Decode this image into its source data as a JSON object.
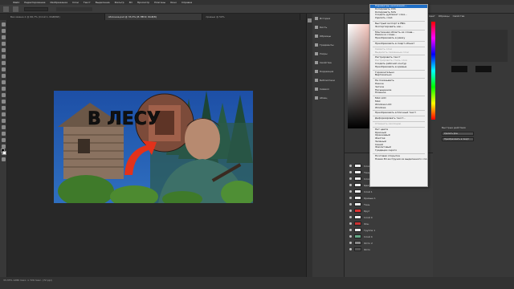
{
  "menubar": {
    "items": [
      "Файл",
      "Редактирование",
      "Изображение",
      "Слои",
      "Текст",
      "Выделение",
      "Фильтр",
      "3D",
      "Просмотр",
      "Плагины",
      "Окно",
      "Справка"
    ]
  },
  "tabs": [
    {
      "label": "Без имени-1 @ 66,7% (Слой 1, RGB/8#)"
    },
    {
      "label": "обложка.psd @ 33,3% (В ЛЕСУ, RGB/8)"
    },
    {
      "label": "превью @ 50%"
    }
  ],
  "artwork": {
    "title": "В ЛЕСУ"
  },
  "status": {
    "text": "33,33%   1280 пикс. x 720 пикс. (72 ppi)"
  },
  "history": {
    "items": [
      "История",
      "Кисть",
      "Образцы",
      "Градиенты",
      "Узоры",
      "Свойства",
      "Коррекция",
      "Библиотеки",
      "Символ",
      "Абзац"
    ]
  },
  "contextmenu": {
    "items": [
      {
        "label": "Параметры наложения...",
        "state": "hl"
      },
      {
        "label": "Копировать CSS",
        "state": ""
      },
      {
        "label": "Копировать SVG",
        "state": ""
      },
      {
        "label": "Создать дубликат слоя...",
        "state": ""
      },
      {
        "label": "Удалить слой",
        "state": ""
      },
      {
        "sep": true
      },
      {
        "label": "Быстрый экспорт в PNG",
        "state": ""
      },
      {
        "label": "Экспортировать как...",
        "state": ""
      },
      {
        "sep": true
      },
      {
        "label": "Монтажная область из слоев...",
        "state": ""
      },
      {
        "label": "Рамка из слоев...",
        "state": ""
      },
      {
        "label": "Преобразовать в рамку",
        "state": ""
      },
      {
        "sep": true
      },
      {
        "label": "Преобразовать в смарт-объект",
        "state": ""
      },
      {
        "sep": true
      },
      {
        "label": "Связать слои",
        "state": "dis"
      },
      {
        "label": "Выделить связанные слои",
        "state": "dis"
      },
      {
        "sep": true
      },
      {
        "label": "Растрировать текст",
        "state": ""
      },
      {
        "label": "Растрировать стиль слоя",
        "state": "dis"
      },
      {
        "label": "Создать рабочий контур",
        "state": ""
      },
      {
        "label": "Преобразовать в кривые",
        "state": ""
      },
      {
        "sep": true
      },
      {
        "label": "Горизонтально",
        "state": ""
      },
      {
        "label": "Вертикально",
        "state": ""
      },
      {
        "sep": true
      },
      {
        "label": "Не показывать",
        "state": ""
      },
      {
        "label": "Резкое",
        "state": ""
      },
      {
        "label": "Четкое",
        "state": ""
      },
      {
        "label": "Насыщенное",
        "state": ""
      },
      {
        "label": "Плавное",
        "state": ""
      },
      {
        "sep": true
      },
      {
        "label": "MAC LCD",
        "state": ""
      },
      {
        "label": "MAC",
        "state": ""
      },
      {
        "label": "Windows LCD",
        "state": ""
      },
      {
        "label": "Windows",
        "state": ""
      },
      {
        "sep": true
      },
      {
        "label": "Преобразовать в блочный текст",
        "state": ""
      },
      {
        "sep": true
      },
      {
        "label": "Деформировать текст...",
        "state": ""
      },
      {
        "sep": true
      },
      {
        "label": "Отменить изоляцию",
        "state": "dis"
      },
      {
        "sep": true
      },
      {
        "label": "Нет цвета",
        "state": ""
      },
      {
        "label": "Красный",
        "state": ""
      },
      {
        "label": "Оранжевый",
        "state": ""
      },
      {
        "label": "Желтая",
        "state": ""
      },
      {
        "label": "Зеленый",
        "state": ""
      },
      {
        "label": "Синий",
        "state": ""
      },
      {
        "label": "Фиолетовый",
        "state": ""
      },
      {
        "label": "Градации серого",
        "state": ""
      },
      {
        "sep": true
      },
      {
        "label": "Почтовая открытка",
        "state": ""
      },
      {
        "label": "Новая 3D-экструзия из выделенного слоя",
        "state": ""
      }
    ]
  },
  "rightpanel": {
    "tabs": [
      "Цвет",
      "Образцы",
      "Свойства"
    ],
    "buttons": [
      "Быстрые действия",
      "Удалить фон",
      "Преобразовать в смарт"
    ]
  },
  "layers": {
    "rows": [
      "Слой 3",
      "Тень",
      "Слой 2",
      "Цвет 1",
      "Слой 1",
      "Кривые 1",
      "Тень",
      "Круг",
      "Слой 0",
      "Фон",
      "Группа 1",
      "Слой 4",
      "Фото 2",
      "Фото"
    ]
  },
  "colors": {
    "accent": "#1f6ec5",
    "menuBg": "#f0f0f0",
    "arrow": "#e3321b"
  }
}
